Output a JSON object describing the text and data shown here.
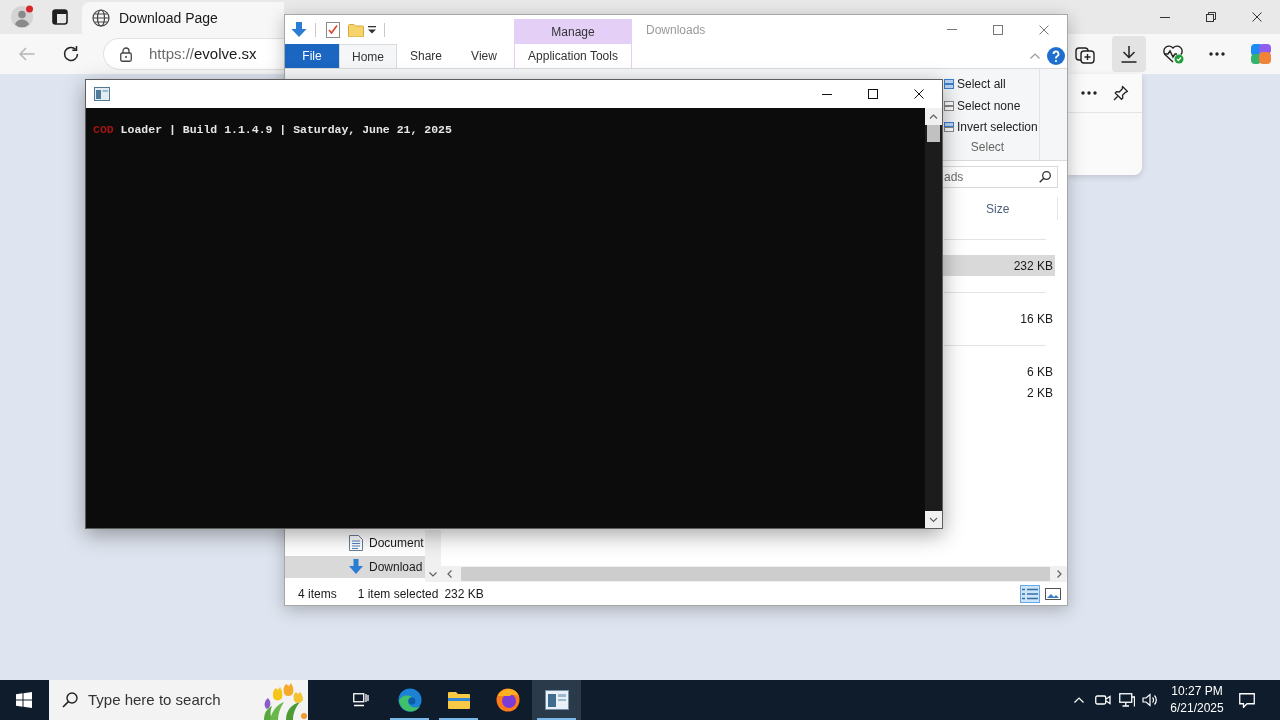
{
  "browser": {
    "tab": {
      "title": "Download Page",
      "selected": true
    },
    "address": {
      "scheme": "https://",
      "host": "evolve.sx"
    },
    "toolbar": [
      {
        "kind": "collections",
        "selected": false
      },
      {
        "kind": "downloads",
        "selected": true
      },
      {
        "kind": "essentials",
        "selected": false
      },
      {
        "kind": "more",
        "selected": false
      },
      {
        "kind": "copilot",
        "selected": false
      }
    ]
  },
  "explorer": {
    "title": "Downloads",
    "context_group": "Manage",
    "tabs": [
      {
        "label": "File",
        "kind": "file",
        "selected": false
      },
      {
        "label": "Home",
        "kind": "tab",
        "selected": true
      },
      {
        "label": "Share",
        "kind": "tab",
        "selected": false
      },
      {
        "label": "View",
        "kind": "tab",
        "selected": false
      },
      {
        "label": "Application Tools",
        "kind": "context",
        "selected": false
      }
    ],
    "select_group": {
      "label": "Select",
      "commands": [
        {
          "label": "Select all",
          "kind": "select_all"
        },
        {
          "label": "Select none",
          "kind": "select_none"
        },
        {
          "label": "Invert selection",
          "kind": "invert"
        }
      ]
    },
    "search": {
      "placeholder": "ads"
    },
    "columns": [
      "Size"
    ],
    "groups": [
      {
        "rows": [
          {
            "size": "232 KB",
            "selected": true
          }
        ]
      },
      {
        "rows": [
          {
            "size": "16 KB",
            "selected": false
          }
        ]
      },
      {
        "rows": [
          {
            "size": "6 KB",
            "selected": false
          },
          {
            "size": "2 KB",
            "selected": false
          }
        ]
      }
    ],
    "sidebar": [
      {
        "label": "Document",
        "kind": "documents",
        "selected": false
      },
      {
        "label": "Download",
        "kind": "downloads",
        "selected": true
      }
    ],
    "status": {
      "items": "4 items",
      "selection": "1 item selected",
      "size": "232 KB"
    },
    "views": [
      {
        "kind": "details",
        "selected": true
      },
      {
        "kind": "large_icons",
        "selected": false
      }
    ]
  },
  "console": {
    "lines": [
      {
        "segments": [
          {
            "text": "COD",
            "color": "#a31515"
          },
          {
            "text": " Loader | Build 1.1.4.9 | Saturday, June 21, 2025",
            "color": "#e6e6e6"
          }
        ]
      }
    ]
  },
  "taskbar": {
    "search": {
      "placeholder": "Type here to search"
    },
    "apps": [
      {
        "kind": "task_view",
        "running": false,
        "selected": false
      },
      {
        "kind": "edge",
        "running": true,
        "selected": false
      },
      {
        "kind": "explorer",
        "running": true,
        "selected": false
      },
      {
        "kind": "firefox",
        "running": false,
        "selected": false
      },
      {
        "kind": "console",
        "running": true,
        "selected": true
      }
    ],
    "clock": {
      "time": "10:27 PM",
      "date": "6/21/2025"
    }
  }
}
